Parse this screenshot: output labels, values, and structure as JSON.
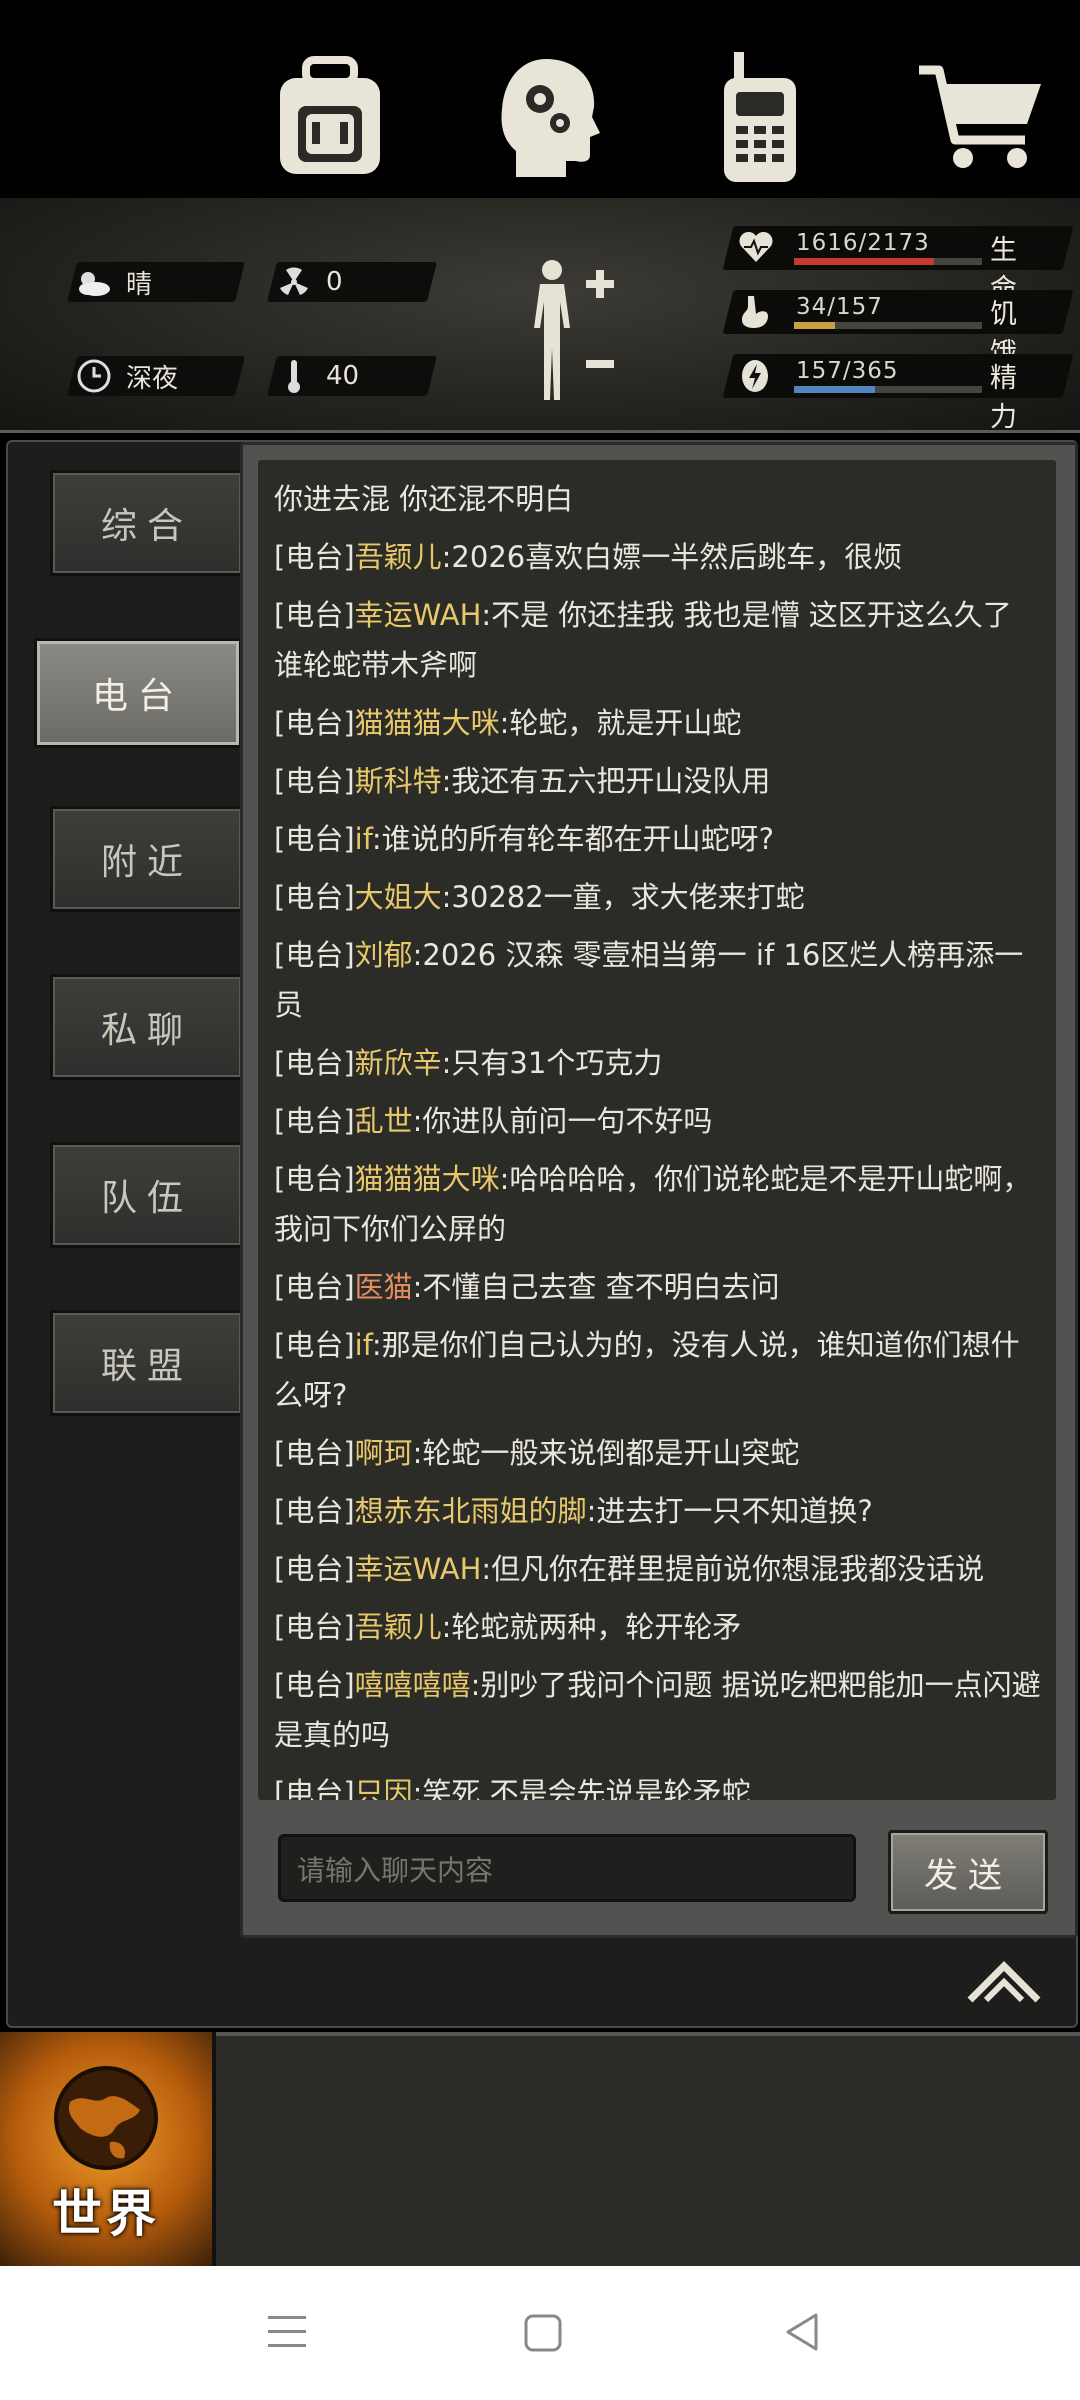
{
  "status": {
    "weather": "晴",
    "radiation": "0",
    "time_of_day": "深夜",
    "temperature": "40"
  },
  "vitals": [
    {
      "label": "生命",
      "value": "1616/2173",
      "fraction": 0.744,
      "color": "#c43a30",
      "icon": "heart-icon"
    },
    {
      "label": "饥饿",
      "value": "34/157",
      "fraction": 0.217,
      "color": "#c9a041",
      "icon": "stomach-icon"
    },
    {
      "label": "精力",
      "value": "157/365",
      "fraction": 0.43,
      "color": "#4f86bf",
      "icon": "energy-icon"
    }
  ],
  "tabs": [
    {
      "label": "综合",
      "active": false
    },
    {
      "label": "电台",
      "active": true
    },
    {
      "label": "附近",
      "active": false
    },
    {
      "label": "私聊",
      "active": false
    },
    {
      "label": "队伍",
      "active": false
    },
    {
      "label": "联盟",
      "active": false
    }
  ],
  "messages": [
    {
      "channel": "",
      "name": "",
      "text": "你进去混 你还混不明白",
      "name_color": "gold"
    },
    {
      "channel": "[电台]",
      "name": "吾颖儿",
      "text": ":2026喜欢白嫖一半然后跳车，很烦",
      "name_color": "gold"
    },
    {
      "channel": "[电台]",
      "name": "幸运WAH",
      "text": ":不是 你还挂我 我也是懵 这区开这么久了 谁轮蛇带木斧啊",
      "name_color": "gold"
    },
    {
      "channel": "[电台]",
      "name": "猫猫猫大咪",
      "text": ":轮蛇，就是开山蛇",
      "name_color": "gold"
    },
    {
      "channel": "[电台]",
      "name": "斯科特",
      "text": ":我还有五六把开山没队用",
      "name_color": "gold"
    },
    {
      "channel": "[电台]",
      "name": "if",
      "text": ":谁说的所有轮车都在开山蛇呀?",
      "name_color": "gold"
    },
    {
      "channel": "[电台]",
      "name": "大姐大",
      "text": ":30282一童，求大佬来打蛇",
      "name_color": "gold"
    },
    {
      "channel": "[电台]",
      "name": "刘郁",
      "text": ":2026 汉森 零壹相当第一 if 16区烂人榜再添一员",
      "name_color": "gold"
    },
    {
      "channel": "[电台]",
      "name": "新欣辛",
      "text": ":只有31个巧克力",
      "name_color": "gold"
    },
    {
      "channel": "[电台]",
      "name": "乱世",
      "text": ":你进队前问一句不好吗",
      "name_color": "gold"
    },
    {
      "channel": "[电台]",
      "name": "猫猫猫大咪",
      "text": ":哈哈哈哈，你们说轮蛇是不是开山蛇啊，我问下你们公屏的",
      "name_color": "gold"
    },
    {
      "channel": "[电台]",
      "name": "医猫",
      "text": ":不懂自己去查 查不明白去问",
      "name_color": "red"
    },
    {
      "channel": "[电台]",
      "name": "if",
      "text": ":那是你们自己认为的，没有人说，谁知道你们想什么呀?",
      "name_color": "gold"
    },
    {
      "channel": "[电台]",
      "name": "啊珂",
      "text": ":轮蛇一般来说倒都是开山突蛇",
      "name_color": "gold"
    },
    {
      "channel": "[电台]",
      "name": "想赤东北雨姐的脚",
      "text": ":进去打一只不知道换?",
      "name_color": "gold"
    },
    {
      "channel": "[电台]",
      "name": "幸运WAH",
      "text": ":但凡你在群里提前说你想混我都没话说",
      "name_color": "gold"
    },
    {
      "channel": "[电台]",
      "name": "吾颖儿",
      "text": ":轮蛇就两种，轮开轮矛",
      "name_color": "gold"
    },
    {
      "channel": "[电台]",
      "name": "嘻嘻嘻嘻",
      "text": ":别吵了我问个问题 据说吃粑粑能加一点闪避是真的吗",
      "name_color": "gold"
    },
    {
      "channel": "[电台]",
      "name": "只因",
      "text": ":笑死 不是会先说是轮矛蛇",
      "name_color": "gold"
    }
  ],
  "input": {
    "placeholder": "请输入聊天内容"
  },
  "send_label": "发送",
  "bottom_nav": {
    "world_label": "世界",
    "items": [
      "backpack-icon",
      "skills-head-icon",
      "radio-icon",
      "shop-cart-icon"
    ]
  }
}
